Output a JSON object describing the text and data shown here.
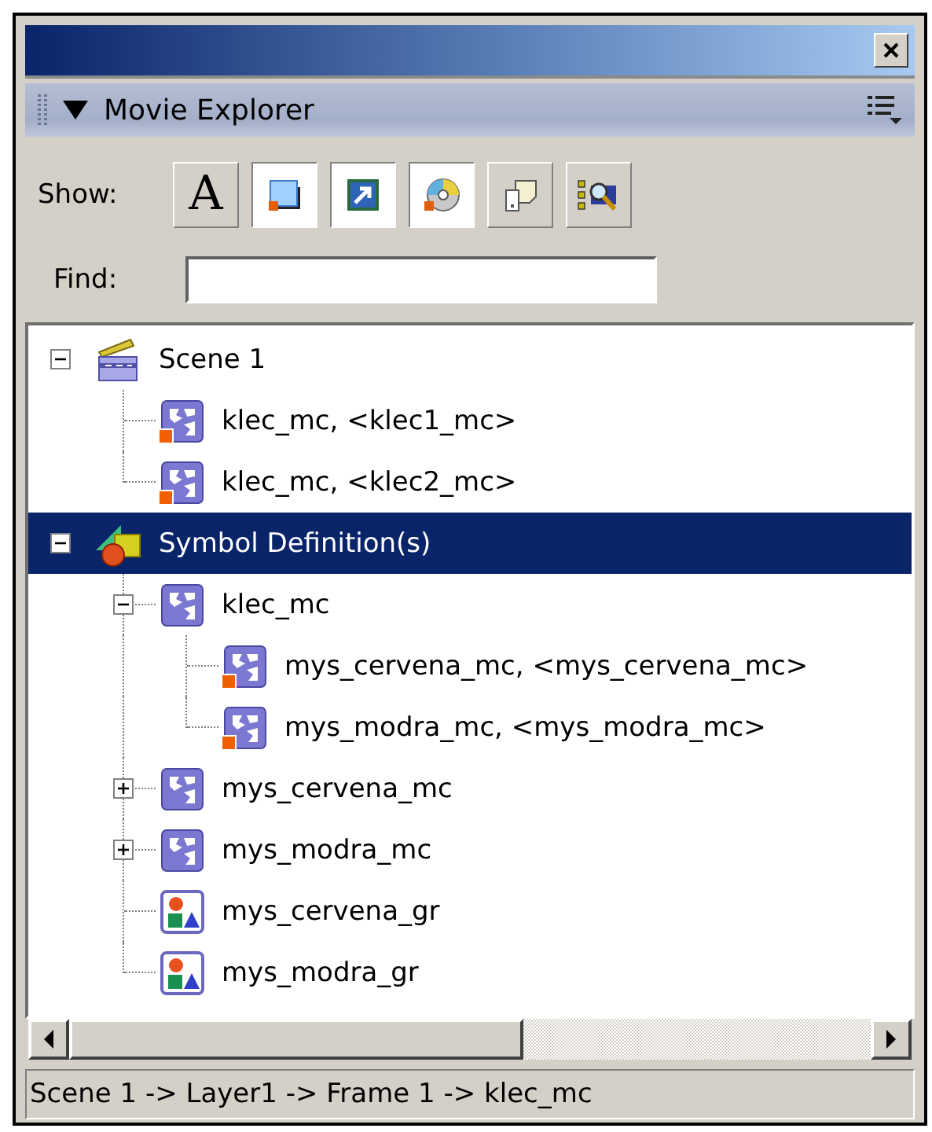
{
  "panel": {
    "title": "Movie Explorer"
  },
  "show": {
    "label": "Show:",
    "buttons": [
      {
        "kind": "text",
        "glyph": "A",
        "selected": false
      },
      {
        "kind": "buttons",
        "selected": true
      },
      {
        "kind": "movieclips",
        "selected": true
      },
      {
        "kind": "media",
        "selected": true
      },
      {
        "kind": "frames",
        "selected": false
      },
      {
        "kind": "customize",
        "selected": false
      }
    ]
  },
  "find": {
    "label": "Find:"
  },
  "tree": [
    {
      "label": "Scene 1",
      "kind": "scene",
      "expanded": true,
      "selected": false,
      "children": [
        {
          "label": "klec_mc, <klec1_mc>",
          "kind": "instance",
          "selected": false
        },
        {
          "label": "klec_mc, <klec2_mc>",
          "kind": "instance",
          "selected": false
        }
      ]
    },
    {
      "label": "Symbol Definition(s)",
      "kind": "symbols",
      "expanded": true,
      "selected": true,
      "children": [
        {
          "label": "klec_mc",
          "kind": "movieclip",
          "expanded": true,
          "selected": false,
          "children": [
            {
              "label": "mys_cervena_mc, <mys_cervena_mc>",
              "kind": "instance",
              "selected": false
            },
            {
              "label": "mys_modra_mc, <mys_modra_mc>",
              "kind": "instance",
              "selected": false
            }
          ]
        },
        {
          "label": "mys_cervena_mc",
          "kind": "movieclip",
          "expanded": false,
          "selected": false
        },
        {
          "label": "mys_modra_mc",
          "kind": "movieclip",
          "expanded": false,
          "selected": false
        },
        {
          "label": "mys_cervena_gr",
          "kind": "graphic",
          "selected": false
        },
        {
          "label": "mys_modra_gr",
          "kind": "graphic",
          "selected": false
        }
      ]
    }
  ],
  "status_bar": "Scene 1 -> Layer1 -> Frame 1 -> klec_mc"
}
